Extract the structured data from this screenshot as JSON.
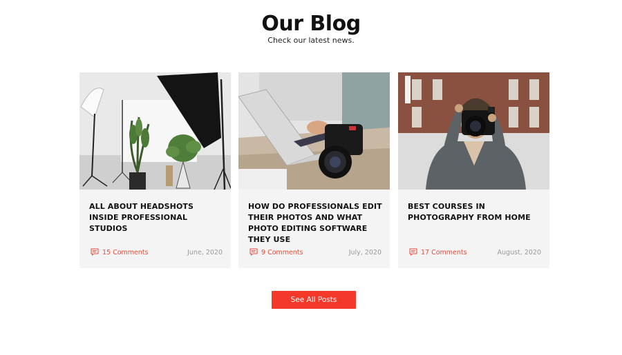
{
  "section": {
    "title": "Our Blog",
    "subtitle": "Check our latest news."
  },
  "posts": [
    {
      "title": "ALL ABOUT HEADSHOTS INSIDE PROFESSIONAL STUDIOS",
      "comments": "15 Comments",
      "date": "June, 2020",
      "image_icon": "photo-studio-image"
    },
    {
      "title": "HOW DO PROFESSIONALS EDIT THEIR PHOTOS AND WHAT PHOTO EDITING SOFTWARE THEY USE",
      "comments": "9 Comments",
      "date": "July, 2020",
      "image_icon": "laptop-camera-image"
    },
    {
      "title": "BEST COURSES IN PHOTOGRAPHY FROM HOME",
      "comments": "17 Comments",
      "date": "August, 2020",
      "image_icon": "photographer-image"
    }
  ],
  "cta": {
    "label": "See All Posts"
  },
  "colors": {
    "accent": "#f4382a",
    "comment_text": "#e8493a",
    "card_bg": "#f4f4f4",
    "date_text": "#9a9a9a"
  },
  "icons": {
    "comment": "comment-icon"
  }
}
